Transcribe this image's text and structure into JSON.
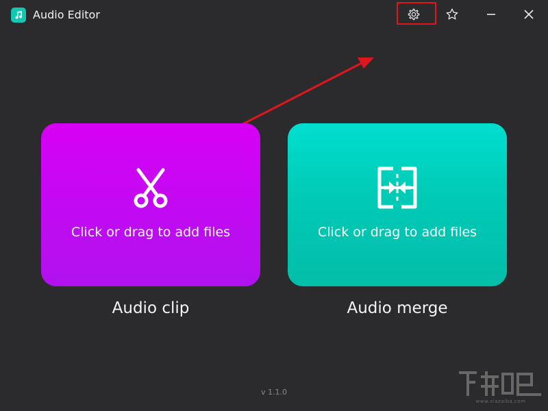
{
  "window": {
    "title": "Audio Editor",
    "icons": {
      "logo": "music-note-icon",
      "settings": "gear-icon",
      "favorite": "star-icon",
      "minimize": "minimize-icon",
      "close": "close-icon"
    }
  },
  "cards": [
    {
      "hint": "Click or drag to add files",
      "label": "Audio clip",
      "icon": "scissors-icon",
      "color": "#c20af3"
    },
    {
      "hint": "Click or drag to add files",
      "label": "Audio merge",
      "icon": "merge-arrows-icon",
      "color": "#00d3c1"
    }
  ],
  "footer": {
    "version": "v 1.1.0"
  },
  "annotation": {
    "highlight_color": "#e0161d"
  },
  "watermark": {
    "text": "www.xiazaiba.com"
  }
}
